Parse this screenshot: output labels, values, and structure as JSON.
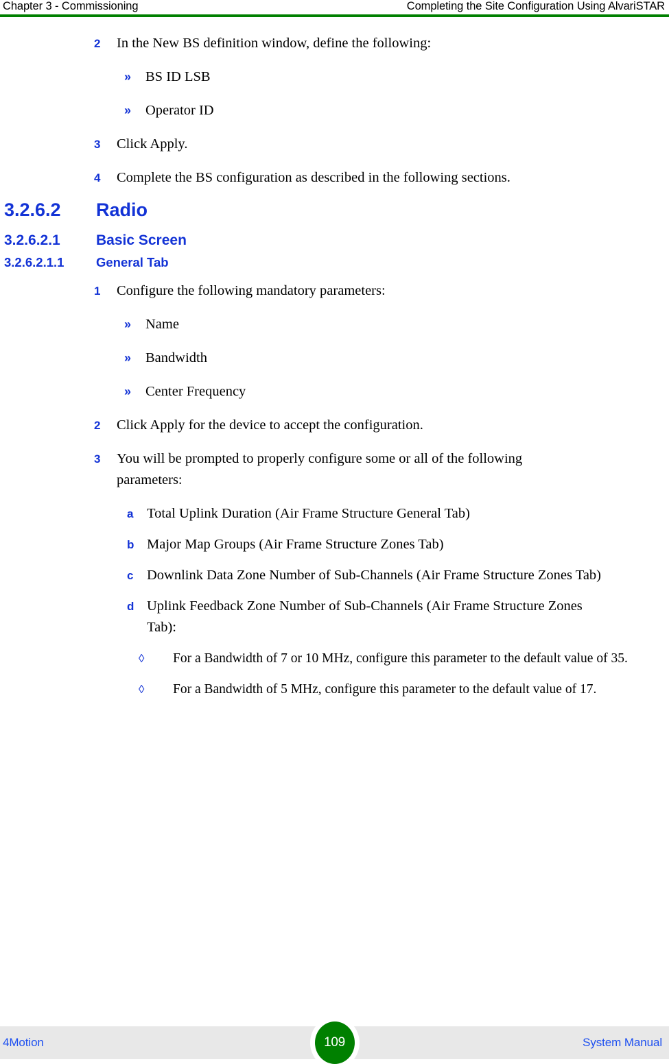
{
  "header": {
    "left": "Chapter 3 - Commissioning",
    "right": "Completing the Site Configuration Using AlvariSTAR",
    "rule_color": "#008000"
  },
  "colors": {
    "marker_blue": "#1333d6",
    "heading_blue": "#1333d6",
    "footer_link_blue": "#1e50f0",
    "badge_green": "#008000",
    "footer_band": "#e8e8e8"
  },
  "body": {
    "step_2": {
      "marker": "2",
      "text": "In the New BS definition window, define the following:"
    },
    "bullet_bs_id": {
      "marker": "»",
      "text": "BS ID LSB"
    },
    "bullet_operator_id": {
      "marker": "»",
      "text": "Operator ID"
    },
    "step_3": {
      "marker": "3",
      "text": "Click Apply."
    },
    "step_4": {
      "marker": "4",
      "text": "Complete the BS configuration as described in the following sections."
    }
  },
  "headings": {
    "radio": {
      "number": "3.2.6.2",
      "title": "Radio"
    },
    "basic_screen": {
      "number": "3.2.6.2.1",
      "title": "Basic Screen"
    },
    "general_tab": {
      "number": "3.2.6.2.1.1",
      "title": "General Tab"
    }
  },
  "general_tab_body": {
    "step_1": {
      "marker": "1",
      "text": "Configure the following mandatory parameters:"
    },
    "bullet_name": {
      "marker": "»",
      "text": "Name"
    },
    "bullet_bandwidth": {
      "marker": "»",
      "text": "Bandwidth"
    },
    "bullet_center_frequency": {
      "marker": "»",
      "text": "Center Frequency"
    },
    "step_2": {
      "marker": "2",
      "text": "Click Apply for the device to accept the configuration."
    },
    "step_3": {
      "marker": "3",
      "text": "You will be prompted to properly configure some or all of the following parameters:"
    },
    "item_a": {
      "marker": "a",
      "text": "Total Uplink Duration (Air Frame Structure General Tab)"
    },
    "item_b": {
      "marker": "b",
      "text": "Major Map Groups (Air Frame Structure Zones Tab)"
    },
    "item_c": {
      "marker": "c",
      "text": "Downlink Data Zone Number of Sub-Channels (Air Frame Structure Zones Tab)"
    },
    "item_d": {
      "marker": "d",
      "text": "Uplink Feedback Zone Number of Sub-Channels (Air Frame Structure Zones Tab):"
    },
    "diamond_1": {
      "marker": "◊",
      "text": "For a Bandwidth of 7 or 10 MHz, configure this parameter to the default value of 35."
    },
    "diamond_2": {
      "marker": "◊",
      "text": "For a Bandwidth of 5 MHz, configure this parameter to the default value of 17."
    }
  },
  "footer": {
    "left": "4Motion",
    "page_number": "109",
    "right": "System Manual"
  }
}
